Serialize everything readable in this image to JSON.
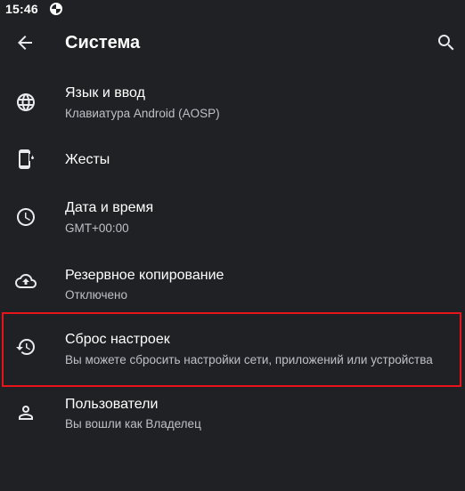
{
  "status_bar": {
    "time": "15:46",
    "notification_icon": "data-saver-icon"
  },
  "app_bar": {
    "back_icon": "arrow-back-icon",
    "title": "Система",
    "search_icon": "search-icon"
  },
  "items": [
    {
      "id": "language",
      "icon": "globe-icon",
      "title": "Язык и ввод",
      "subtitle": "Клавиатура Android (AOSP)"
    },
    {
      "id": "gestures",
      "icon": "phone-gesture-icon",
      "title": "Жесты",
      "subtitle": ""
    },
    {
      "id": "datetime",
      "icon": "clock-icon",
      "title": "Дата и время",
      "subtitle": "GMT+00:00"
    },
    {
      "id": "backup",
      "icon": "cloud-upload-icon",
      "title": "Резервное копирование",
      "subtitle": "Отключено"
    },
    {
      "id": "reset",
      "icon": "history-icon",
      "title": "Сброс настроек",
      "subtitle": "Вы можете сбросить настройки сети, приложений или устройства",
      "highlighted": true
    },
    {
      "id": "users",
      "icon": "person-icon",
      "title": "Пользователи",
      "subtitle": "Вы вошли как Владелец"
    }
  ],
  "colors": {
    "background": "#202124",
    "primary_text": "#ffffff",
    "secondary_text": "#bdc1c6",
    "icon": "#e8eaed",
    "highlight": "#e8141b"
  }
}
